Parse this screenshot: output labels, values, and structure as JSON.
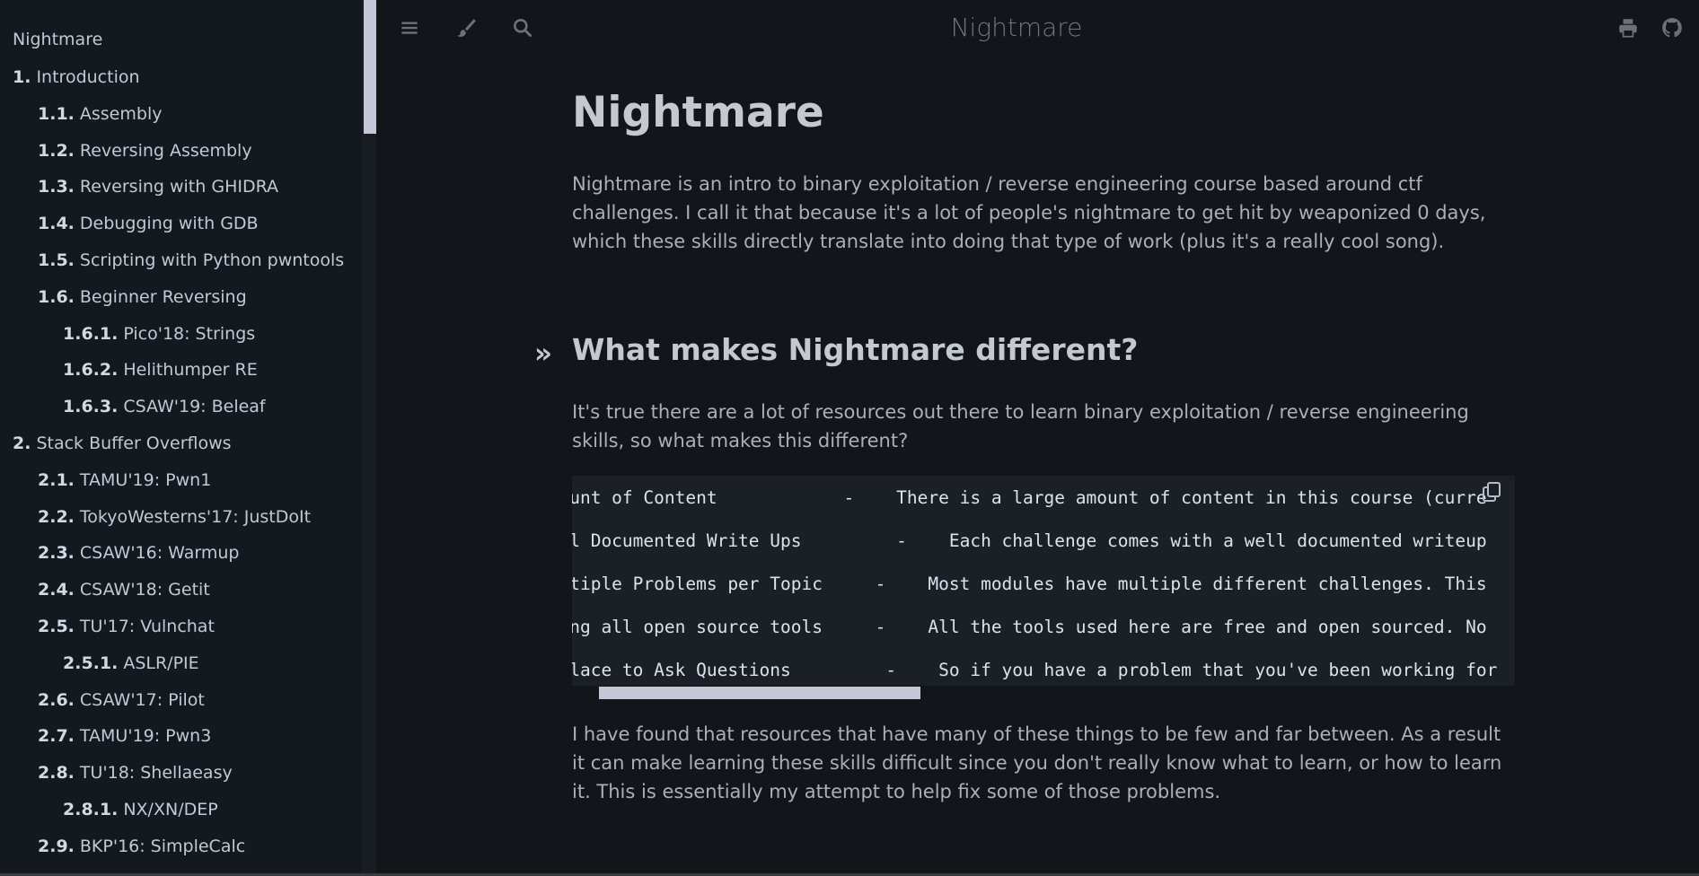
{
  "book_title": "Nightmare",
  "sidebar": {
    "title": "Nightmare",
    "items": [
      {
        "num": "1.",
        "label": "Introduction",
        "level": 0
      },
      {
        "num": "1.1.",
        "label": "Assembly",
        "level": 1
      },
      {
        "num": "1.2.",
        "label": "Reversing Assembly",
        "level": 1
      },
      {
        "num": "1.3.",
        "label": "Reversing with GHIDRA",
        "level": 1
      },
      {
        "num": "1.4.",
        "label": "Debugging with GDB",
        "level": 1
      },
      {
        "num": "1.5.",
        "label": "Scripting with Python pwntools",
        "level": 1
      },
      {
        "num": "1.6.",
        "label": "Beginner Reversing",
        "level": 1
      },
      {
        "num": "1.6.1.",
        "label": "Pico'18: Strings",
        "level": 2
      },
      {
        "num": "1.6.2.",
        "label": "Helithumper RE",
        "level": 2
      },
      {
        "num": "1.6.3.",
        "label": "CSAW'19: Beleaf",
        "level": 2
      },
      {
        "num": "2.",
        "label": "Stack Buffer Overflows",
        "level": 0
      },
      {
        "num": "2.1.",
        "label": "TAMU'19: Pwn1",
        "level": 1
      },
      {
        "num": "2.2.",
        "label": "TokyoWesterns'17: JustDoIt",
        "level": 1
      },
      {
        "num": "2.3.",
        "label": "CSAW'16: Warmup",
        "level": 1
      },
      {
        "num": "2.4.",
        "label": "CSAW'18: Getit",
        "level": 1
      },
      {
        "num": "2.5.",
        "label": "TU'17: Vulnchat",
        "level": 1
      },
      {
        "num": "2.5.1.",
        "label": "ASLR/PIE",
        "level": 2
      },
      {
        "num": "2.6.",
        "label": "CSAW'17: Pilot",
        "level": 1
      },
      {
        "num": "2.7.",
        "label": "TAMU'19: Pwn3",
        "level": 1
      },
      {
        "num": "2.8.",
        "label": "TU'18: Shellaeasy",
        "level": 1
      },
      {
        "num": "2.8.1.",
        "label": "NX/XN/DEP",
        "level": 2
      },
      {
        "num": "2.9.",
        "label": "BKP'16: SimpleCalc",
        "level": 1
      }
    ]
  },
  "toolbar": {
    "icons": [
      "menu-icon",
      "paintbrush-icon",
      "search-icon",
      "print-icon",
      "github-icon"
    ]
  },
  "content": {
    "h1": "Nightmare",
    "intro": "Nightmare is an intro to binary exploitation / reverse engineering course based around ctf challenges. I call it that because it's a lot of people's nightmare to get hit by weaponized 0 days, which these skills directly translate into doing that type of work (plus it's a really cool song).",
    "anchor": "»",
    "h2": "What makes Nightmare different?",
    "p2": "It's true there are a lot of resources out there to learn binary exploitation / reverse engineering skills, so what makes this different?",
    "code_lines": [
      "Amount of Content            -    There is a large amount of content in this course (curre",
      "Well Documented Write Ups         -    Each challenge comes with a well documented writeup",
      "Multiple Problems per Topic     -    Most modules have multiple different challenges. This",
      "Using all open source tools     -    All the tools used here are free and open sourced. No",
      "A Place to Ask Questions         -    So if you have a problem that you've been working for"
    ],
    "p3": "I have found that resources that have many of these things to be few and far between. As a result it can make learning these skills difficult since you don't really know what to learn, or how to learn it. This is essentially my attempt to help fix some of those problems."
  }
}
